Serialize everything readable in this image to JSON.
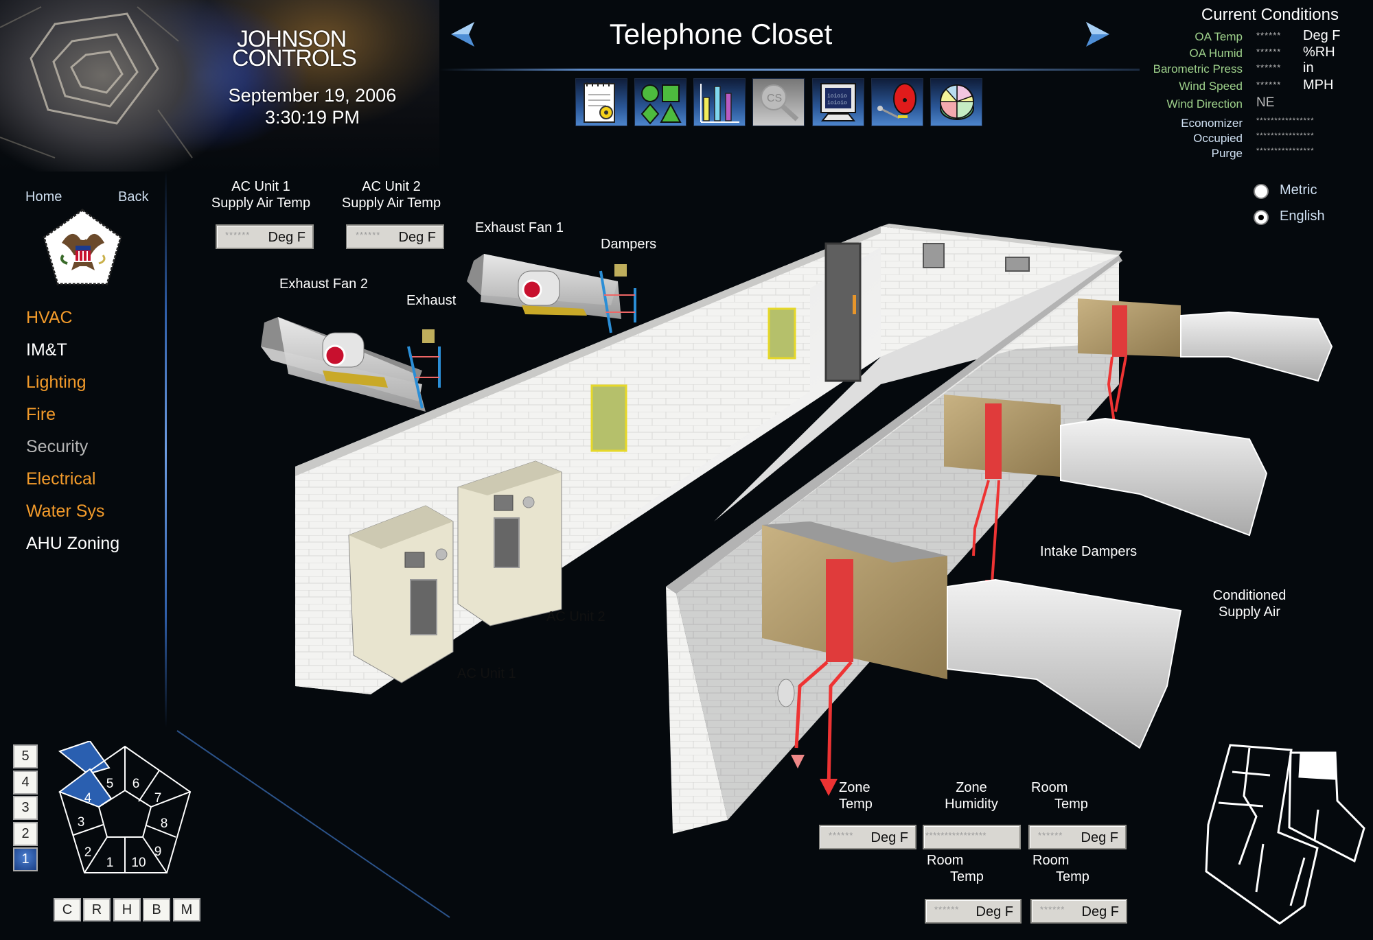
{
  "header": {
    "brand_line1": "JOHNSON",
    "brand_line2": "CONTROLS",
    "date": "September 19, 2006",
    "time": "3:30:19 PM",
    "page_title": "Telephone Closet",
    "prev_icon": "left-arrow-icon",
    "next_icon": "right-arrow-icon"
  },
  "toolbar": {
    "items": [
      {
        "icon": "notepad-gear-icon",
        "label": "Notes / Settings",
        "enabled": true
      },
      {
        "icon": "shapes-icon",
        "label": "Graphics",
        "enabled": true
      },
      {
        "icon": "bar-chart-icon",
        "label": "Trends",
        "enabled": true
      },
      {
        "icon": "cs-magnifier-icon",
        "label": "CS Search",
        "text": "CS",
        "enabled": false
      },
      {
        "icon": "monitor-icon",
        "label": "Monitor",
        "text": "ioioio",
        "enabled": true
      },
      {
        "icon": "alarm-bell-icon",
        "label": "Alarms",
        "enabled": true
      },
      {
        "icon": "pie-chart-icon",
        "label": "Reports",
        "enabled": true
      }
    ]
  },
  "current_conditions": {
    "title": "Current Conditions",
    "rows": [
      {
        "label": "OA Temp",
        "value": "******",
        "unit": "Deg F"
      },
      {
        "label": "OA Humid",
        "value": "******",
        "unit": "%RH"
      },
      {
        "label": "Barometric Press",
        "value": "******",
        "unit": "in"
      },
      {
        "label": "Wind Speed",
        "value": "******",
        "unit": "MPH"
      },
      {
        "label": "Wind Direction",
        "value": "NE",
        "unit": ""
      }
    ],
    "status_rows": [
      {
        "label": "Economizer",
        "value": "****************"
      },
      {
        "label": "Occupied",
        "value": "****************"
      },
      {
        "label": "Purge",
        "value": "****************"
      }
    ]
  },
  "units": {
    "options": [
      {
        "label": "Metric",
        "selected": false
      },
      {
        "label": "English",
        "selected": true
      }
    ]
  },
  "sidebar": {
    "home": "Home",
    "back": "Back",
    "seal_icon": "pentagon-eagle-seal-icon",
    "items": [
      {
        "label": "HVAC",
        "color": "#f39b2b"
      },
      {
        "label": "IM&T",
        "color": "#ffffff"
      },
      {
        "label": "Lighting",
        "color": "#f39b2b"
      },
      {
        "label": "Fire",
        "color": "#f39b2b"
      },
      {
        "label": "Security",
        "color": "#b5b5b5"
      },
      {
        "label": "Electrical",
        "color": "#f39b2b"
      },
      {
        "label": "Water Sys",
        "color": "#f39b2b"
      },
      {
        "label": "AHU Zoning",
        "color": "#ffffff"
      }
    ]
  },
  "floors": {
    "buttons": [
      "5",
      "4",
      "3",
      "2",
      "1"
    ],
    "active": "1"
  },
  "wedges": {
    "labels": [
      "1",
      "2",
      "3",
      "4",
      "5",
      "6",
      "7",
      "8",
      "9",
      "10"
    ],
    "active": "4"
  },
  "rings": {
    "buttons": [
      "C",
      "R",
      "H",
      "B",
      "M"
    ]
  },
  "diagram": {
    "labels": {
      "ac1_supply": [
        "AC Unit 1",
        "Supply Air Temp"
      ],
      "ac2_supply": [
        "AC Unit 2",
        "Supply Air Temp"
      ],
      "exhaust_fan_1": "Exhaust Fan 1",
      "exhaust_fan_2": "Exhaust Fan 2",
      "dampers": "Dampers",
      "exhaust": "Exhaust",
      "ac_unit_1": "AC Unit 1",
      "ac_unit_2": "AC Unit 2",
      "intake_dampers": "Intake Dampers",
      "conditioned_supply_air": [
        "Conditioned",
        "Supply Air"
      ]
    },
    "readouts": {
      "ac1_supply": {
        "value": "******",
        "unit": "Deg F"
      },
      "ac2_supply": {
        "value": "******",
        "unit": "Deg F"
      }
    }
  },
  "zone_readouts": [
    {
      "label": [
        "Zone",
        "Temp"
      ],
      "value": "******",
      "unit": "Deg F"
    },
    {
      "label": [
        "Zone",
        "Humidity"
      ],
      "value": "****************",
      "unit": ""
    },
    {
      "label": [
        "Room",
        "Temp"
      ],
      "value": "******",
      "unit": "Deg F"
    },
    {
      "label": [
        "Room",
        "Temp"
      ],
      "value": "******",
      "unit": "Deg F"
    },
    {
      "label": [
        "Room",
        "Temp"
      ],
      "value": "******",
      "unit": "Deg F"
    }
  ],
  "minimap": {
    "icon": "building-floorplan-map-icon",
    "highlighted_zone": "north-east"
  }
}
